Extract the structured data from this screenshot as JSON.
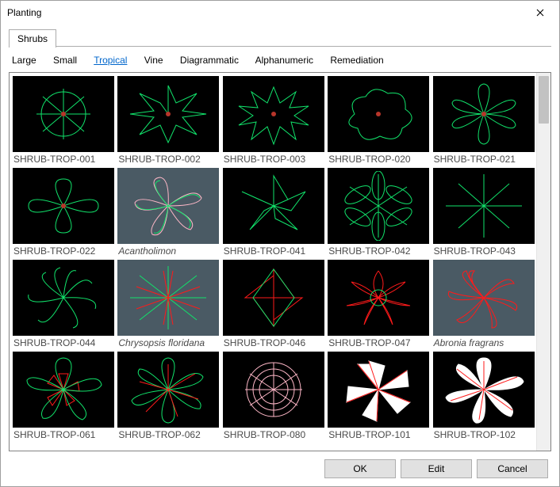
{
  "window": {
    "title": "Planting"
  },
  "tabs": {
    "primary": [
      "Shrubs"
    ],
    "filters": [
      "Large",
      "Small",
      "Tropical",
      "Vine",
      "Diagrammatic",
      "Alphanumeric",
      "Remediation"
    ],
    "selected_filter": "Tropical"
  },
  "buttons": {
    "ok": "OK",
    "edit": "Edit",
    "cancel": "Cancel"
  },
  "items": [
    {
      "label": "SHRUB-TROP-001",
      "italic": false,
      "selected": false,
      "shape": "gear"
    },
    {
      "label": "SHRUB-TROP-002",
      "italic": false,
      "selected": false,
      "shape": "spiky"
    },
    {
      "label": "SHRUB-TROP-003",
      "italic": false,
      "selected": false,
      "shape": "sun"
    },
    {
      "label": "SHRUB-TROP-020",
      "italic": false,
      "selected": false,
      "shape": "cloud"
    },
    {
      "label": "SHRUB-TROP-021",
      "italic": false,
      "selected": false,
      "shape": "flower6"
    },
    {
      "label": "SHRUB-TROP-022",
      "italic": false,
      "selected": false,
      "shape": "clover"
    },
    {
      "label": "Acantholimon",
      "italic": true,
      "selected": true,
      "shape": "pinwheel"
    },
    {
      "label": "SHRUB-TROP-041",
      "italic": false,
      "selected": false,
      "shape": "leaf5"
    },
    {
      "label": "SHRUB-TROP-042",
      "italic": false,
      "selected": false,
      "shape": "leaf6"
    },
    {
      "label": "SHRUB-TROP-043",
      "italic": false,
      "selected": false,
      "shape": "star8"
    },
    {
      "label": "SHRUB-TROP-044",
      "italic": false,
      "selected": false,
      "shape": "swirl"
    },
    {
      "label": "Chrysopsis floridana",
      "italic": true,
      "selected": true,
      "shape": "redstar"
    },
    {
      "label": "SHRUB-TROP-046",
      "italic": false,
      "selected": false,
      "shape": "quad"
    },
    {
      "label": "SHRUB-TROP-047",
      "italic": false,
      "selected": false,
      "shape": "mandala"
    },
    {
      "label": "Abronia fragrans",
      "italic": true,
      "selected": true,
      "shape": "scribble"
    },
    {
      "label": "SHRUB-TROP-061",
      "italic": false,
      "selected": false,
      "shape": "redcore"
    },
    {
      "label": "SHRUB-TROP-062",
      "italic": false,
      "selected": false,
      "shape": "greenfan"
    },
    {
      "label": "SHRUB-TROP-080",
      "italic": false,
      "selected": false,
      "shape": "coral"
    },
    {
      "label": "SHRUB-TROP-101",
      "italic": false,
      "selected": false,
      "shape": "white1"
    },
    {
      "label": "SHRUB-TROP-102",
      "italic": false,
      "selected": false,
      "shape": "white2"
    }
  ]
}
